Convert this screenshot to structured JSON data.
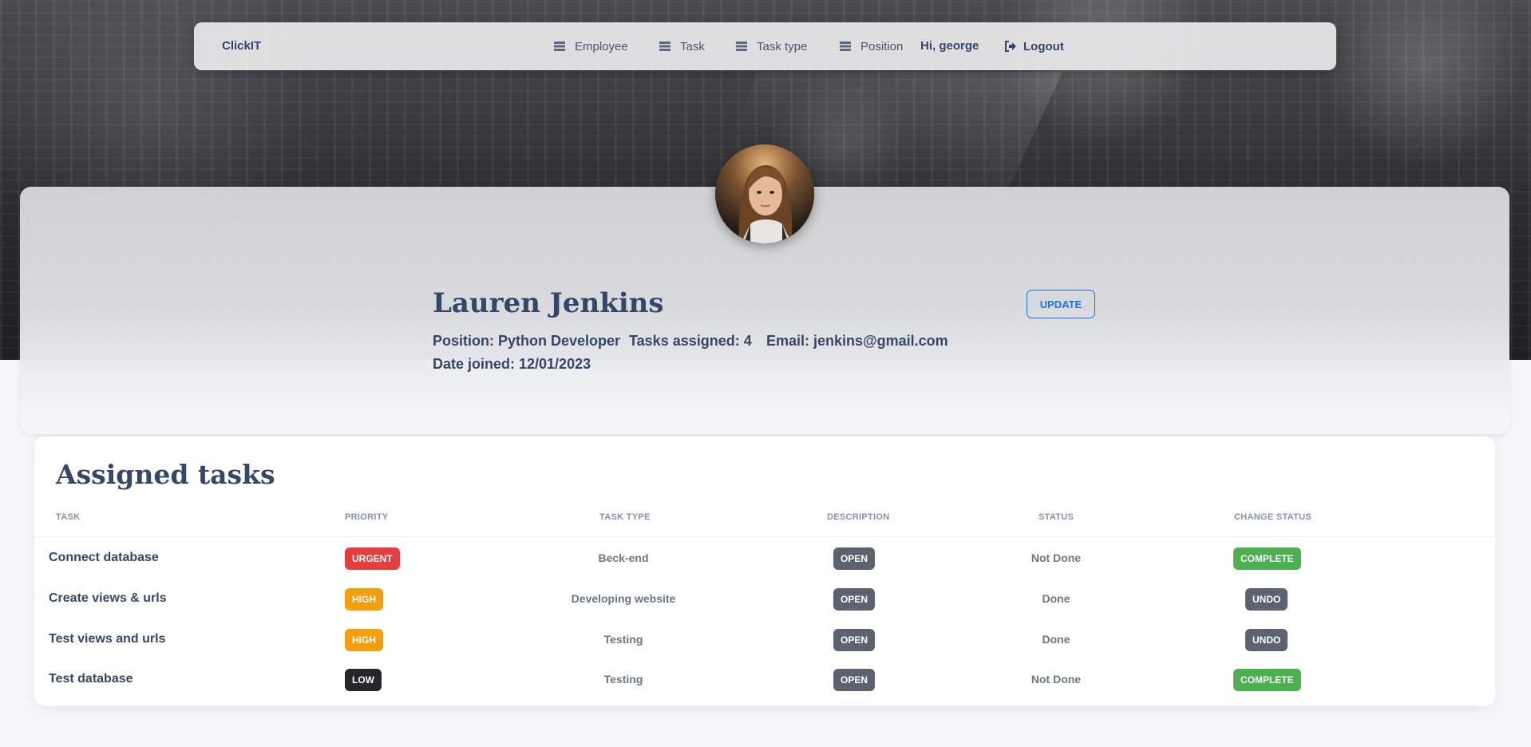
{
  "navbar": {
    "brand": "ClickIT",
    "items": [
      {
        "label": "Employee",
        "icon": "list-icon"
      },
      {
        "label": "Task",
        "icon": "list-icon"
      },
      {
        "label": "Task type",
        "icon": "list-icon"
      },
      {
        "label": "Position",
        "icon": "list-icon"
      }
    ],
    "greeting": "Hi, george",
    "logout_label": "Logout"
  },
  "profile": {
    "name": "Lauren Jenkins",
    "update_label": "UPDATE",
    "position": "Position: Python Developer",
    "tasks_assigned": "Tasks assigned: 4",
    "email": "Email: jenkins@gmail.com",
    "date_joined": "Date joined: 12/01/2023"
  },
  "tasks": {
    "title": "Assigned tasks",
    "columns": [
      "TASK",
      "PRIORITY",
      "TASK TYPE",
      "DESCRIPTION",
      "STATUS",
      "CHANGE STATUS"
    ],
    "rows": [
      {
        "task": "Connect database",
        "priority": "URGENT",
        "type": "Beck-end",
        "description": "OPEN",
        "status": "Not Done",
        "action": "COMPLETE"
      },
      {
        "task": "Create views & urls",
        "priority": "HIGH",
        "type": "Developing website",
        "description": "OPEN",
        "status": "Done",
        "action": "UNDO"
      },
      {
        "task": "Test views and urls",
        "priority": "HIGH",
        "type": "Testing",
        "description": "OPEN",
        "status": "Done",
        "action": "UNDO"
      },
      {
        "task": "Test database",
        "priority": "LOW",
        "type": "Testing",
        "description": "OPEN",
        "status": "Not Done",
        "action": "COMPLETE"
      }
    ]
  },
  "colors": {
    "urgent": "#e53e3e",
    "high": "#f59e0b",
    "low": "#262628",
    "open": "#5c6270",
    "complete": "#4caf50",
    "undo": "#5c6270",
    "accent": "#1a73e8"
  }
}
